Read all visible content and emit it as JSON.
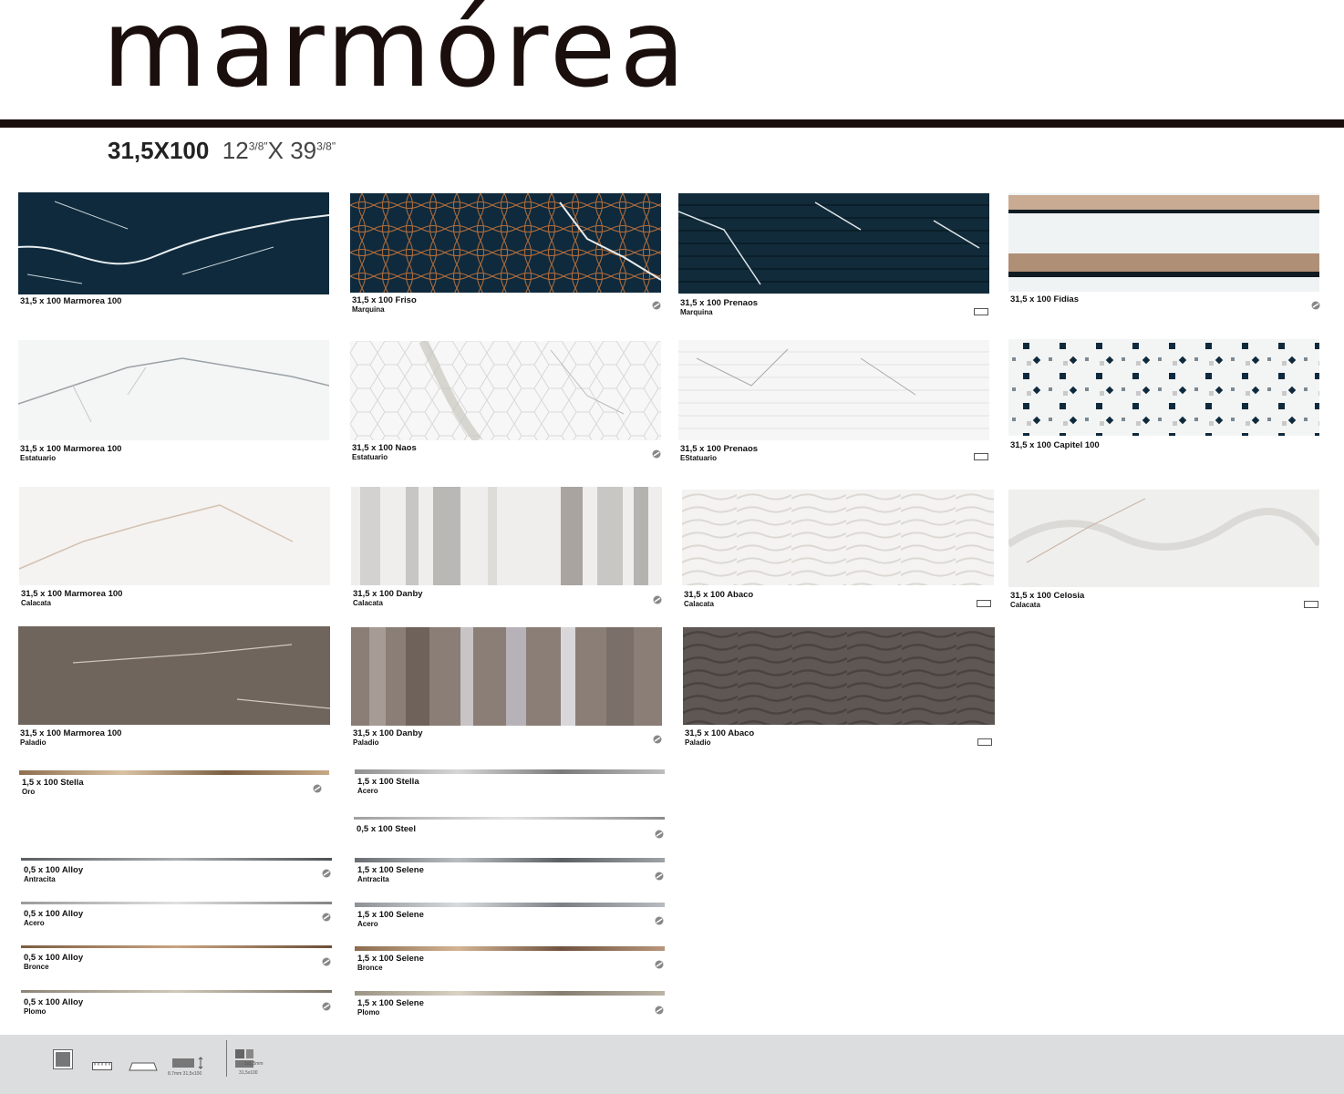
{
  "header": {
    "title": "marmórea",
    "size_metric": "31,5X100",
    "size_imperial_a": "12",
    "size_imperial_a_frac": "3/8\"",
    "size_imperial_sep": "X 39",
    "size_imperial_b_frac": "3/8\""
  },
  "tiles": [
    {
      "label": "31,5 x 100 Marmorea 100",
      "sub": ""
    },
    {
      "label": "31,5 x 100 Friso",
      "sub": "Marquina"
    },
    {
      "label": "31,5 x 100 Prenaos",
      "sub": "Marquina"
    },
    {
      "label": "31,5 x 100 Fidias",
      "sub": ""
    },
    {
      "label": "31,5 x 100 Marmorea 100",
      "sub": "Estatuario"
    },
    {
      "label": "31,5 x 100 Naos",
      "sub": "Estatuario"
    },
    {
      "label": "31,5 x 100 Prenaos",
      "sub": "EStatuario"
    },
    {
      "label": "31,5 x 100 Capitel 100",
      "sub": ""
    },
    {
      "label": "31,5 x 100 Marmorea 100",
      "sub": "Calacata"
    },
    {
      "label": "31,5 x 100 Danby",
      "sub": "Calacata"
    },
    {
      "label": "31,5 x 100 Abaco",
      "sub": "Calacata"
    },
    {
      "label": "31,5 x 100 Celosia",
      "sub": "Calacata"
    },
    {
      "label": "31,5 x 100 Marmorea 100",
      "sub": "Paladio"
    },
    {
      "label": "31,5 x 100 Danby",
      "sub": "Paladio"
    },
    {
      "label": "31,5 x 100 Abaco",
      "sub": "Paladio"
    }
  ],
  "strips": [
    {
      "label": "1,5 x 100 Stella",
      "sub": "Oro"
    },
    {
      "label": "1,5 x 100 Stella",
      "sub": "Acero"
    },
    {
      "label": "0,5 x 100 Steel",
      "sub": ""
    },
    {
      "label": "0,5 x 100 Alloy",
      "sub": "Antracita"
    },
    {
      "label": "1,5 x 100 Selene",
      "sub": "Antracita"
    },
    {
      "label": "0,5 x 100 Alloy",
      "sub": "Acero"
    },
    {
      "label": "1,5 x 100 Selene",
      "sub": "Acero"
    },
    {
      "label": "0,5 x 100 Alloy",
      "sub": "Bronce"
    },
    {
      "label": "1,5 x 100 Selene",
      "sub": "Bronce"
    },
    {
      "label": "0,5 x 100 Alloy",
      "sub": "Plomo"
    },
    {
      "label": "1,5 x 100 Selene",
      "sub": "Plomo"
    }
  ],
  "footer": {
    "thickness_note": "8,7mm 31,5x100",
    "mosaic_note": "31,5x100",
    "mosaic_size": "1x1,5mm"
  },
  "icon_names": [
    "rectified-icon",
    "relief-icon",
    "metal-finish-icon",
    "thickness-icon",
    "mosaic-icon"
  ],
  "colors": {
    "title": "#1a0f0d",
    "marquina": "#0f2a3c",
    "paladio": "#6f655c",
    "footer": "#dcdddf"
  }
}
